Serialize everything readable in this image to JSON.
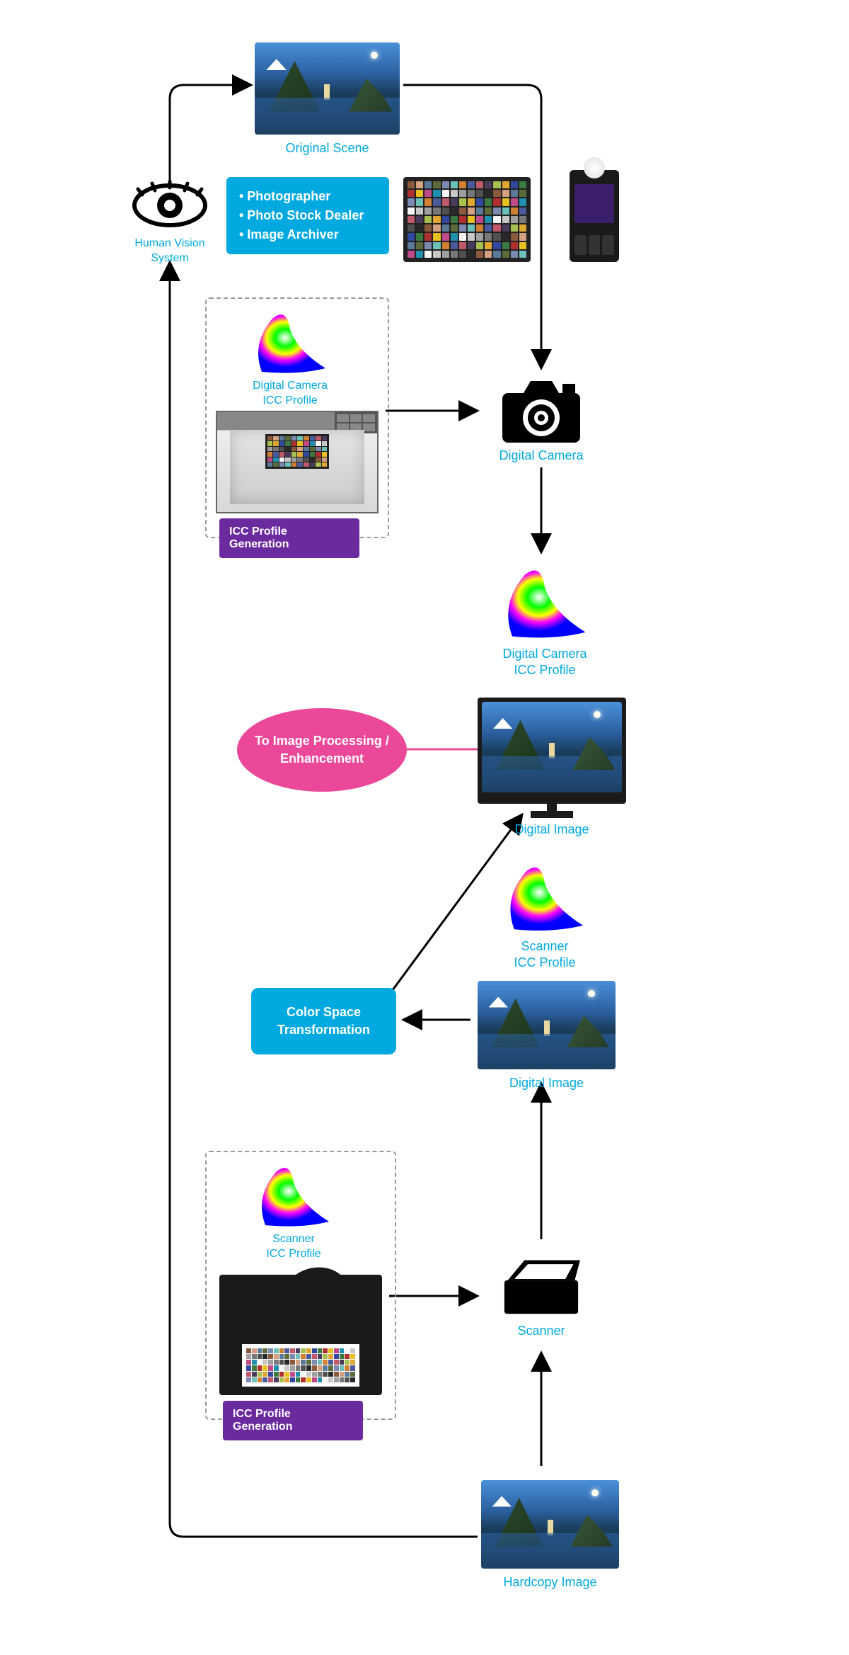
{
  "labels": {
    "human_vision_l1": "Human Vision",
    "human_vision_l2": "System",
    "original_scene": "Original Scene",
    "roles_1": "• Photographer",
    "roles_2": "• Photo Stock Dealer",
    "roles_3": "• Image Archiver",
    "camera_icc_l1": "Digital Camera",
    "camera_icc_l2": "ICC Profile",
    "icc_gen": "ICC Profile Generation",
    "digital_camera": "Digital Camera",
    "camera_icc2_l1": "Digital Camera",
    "camera_icc2_l2": "ICC Profile",
    "to_processing_l1": "To Image Processing /",
    "to_processing_l2": "Enhancement",
    "digital_image_1": "Digital Image",
    "scanner_icc_l1": "Scanner",
    "scanner_icc_l2": "ICC Profile",
    "cst_l1": "Color Space",
    "cst_l2": "Transformation",
    "digital_image_2": "Digital Image",
    "scanner_icc2_l1": "Scanner",
    "scanner_icc2_l2": "ICC Profile",
    "icc_gen_2": "ICC Profile Generation",
    "scanner": "Scanner",
    "hardcopy": "Hardcopy Image"
  }
}
